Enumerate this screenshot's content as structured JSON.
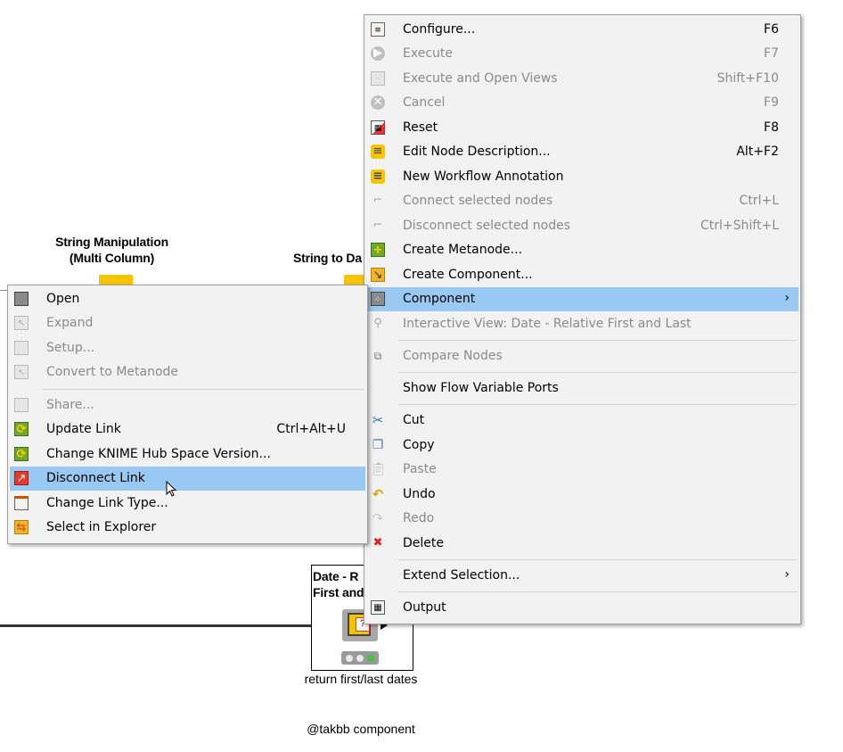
{
  "canvas": {
    "node1_title_line1": "String Manipulation",
    "node1_title_line2": "(Multi Column)",
    "node2_title": "String to Da",
    "component_title_line1": "Date - R",
    "component_title_line2": "First and",
    "component_label": "return first/last dates",
    "annotation": "@takbb component"
  },
  "main_menu": {
    "items": [
      {
        "label": "Configure...",
        "shortcut": "F6",
        "icon": "configure-icon",
        "disabled": false
      },
      {
        "label": "Execute",
        "shortcut": "F7",
        "icon": "execute-icon",
        "disabled": true
      },
      {
        "label": "Execute and Open Views",
        "shortcut": "Shift+F10",
        "icon": "execute-open-views-icon",
        "disabled": true
      },
      {
        "label": "Cancel",
        "shortcut": "F9",
        "icon": "cancel-icon",
        "disabled": true
      },
      {
        "label": "Reset",
        "shortcut": "F8",
        "icon": "reset-icon",
        "disabled": false
      },
      {
        "label": "Edit Node Description...",
        "shortcut": "Alt+F2",
        "icon": "node-description-icon",
        "disabled": false
      },
      {
        "label": "New Workflow Annotation",
        "shortcut": "",
        "icon": "annotation-icon",
        "disabled": false
      },
      {
        "label": "Connect selected nodes",
        "shortcut": "Ctrl+L",
        "icon": "connect-icon",
        "disabled": true
      },
      {
        "label": "Disconnect selected nodes",
        "shortcut": "Ctrl+Shift+L",
        "icon": "disconnect-icon",
        "disabled": true
      },
      {
        "label": "Create Metanode...",
        "shortcut": "",
        "icon": "create-metanode-icon",
        "disabled": false
      },
      {
        "label": "Create Component...",
        "shortcut": "",
        "icon": "create-component-icon",
        "disabled": false
      },
      {
        "label": "Component",
        "shortcut": "",
        "icon": "component-icon",
        "disabled": false
      },
      {
        "label": "Interactive View: Date - Relative First and Last",
        "shortcut": "",
        "icon": "magnifier-icon",
        "disabled": true
      },
      {
        "label": "Compare Nodes",
        "shortcut": "",
        "icon": "compare-nodes-icon",
        "disabled": true
      },
      {
        "label": "Show Flow Variable Ports",
        "shortcut": "",
        "icon": "",
        "disabled": false
      },
      {
        "label": "Cut",
        "shortcut": "",
        "icon": "scissors-icon",
        "disabled": false
      },
      {
        "label": "Copy",
        "shortcut": "",
        "icon": "copy-icon",
        "disabled": false
      },
      {
        "label": "Paste",
        "shortcut": "",
        "icon": "paste-icon",
        "disabled": true
      },
      {
        "label": "Undo",
        "shortcut": "",
        "icon": "undo-icon",
        "disabled": false
      },
      {
        "label": "Redo",
        "shortcut": "",
        "icon": "redo-icon",
        "disabled": true
      },
      {
        "label": "Delete",
        "shortcut": "",
        "icon": "delete-icon",
        "disabled": false
      },
      {
        "label": "Extend Selection...",
        "shortcut": "",
        "icon": "",
        "disabled": false
      },
      {
        "label": "Output",
        "shortcut": "",
        "icon": "output-table-icon",
        "disabled": false
      }
    ],
    "submenu_arrow": "›"
  },
  "sub_menu": {
    "items": [
      {
        "label": "Open",
        "shortcut": "",
        "icon": "open-icon",
        "disabled": false
      },
      {
        "label": "Expand",
        "shortcut": "",
        "icon": "expand-icon",
        "disabled": true
      },
      {
        "label": "Setup...",
        "shortcut": "",
        "icon": "setup-icon",
        "disabled": true
      },
      {
        "label": "Convert to Metanode",
        "shortcut": "",
        "icon": "convert-metanode-icon",
        "disabled": true
      },
      {
        "label": "Share...",
        "shortcut": "",
        "icon": "share-icon",
        "disabled": true
      },
      {
        "label": "Update Link",
        "shortcut": "Ctrl+Alt+U",
        "icon": "update-link-icon",
        "disabled": false
      },
      {
        "label": "Change KNIME Hub Space Version...",
        "shortcut": "",
        "icon": "change-version-icon",
        "disabled": false
      },
      {
        "label": "Disconnect Link",
        "shortcut": "",
        "icon": "disconnect-link-icon",
        "disabled": false
      },
      {
        "label": "Change Link Type...",
        "shortcut": "",
        "icon": "change-link-type-icon",
        "disabled": false
      },
      {
        "label": "Select in Explorer",
        "shortcut": "",
        "icon": "select-explorer-icon",
        "disabled": false
      }
    ]
  },
  "colors": {
    "highlight": "#99c9f2",
    "menu_bg": "#f2f2f2",
    "node_yellow": "#f6c400"
  }
}
